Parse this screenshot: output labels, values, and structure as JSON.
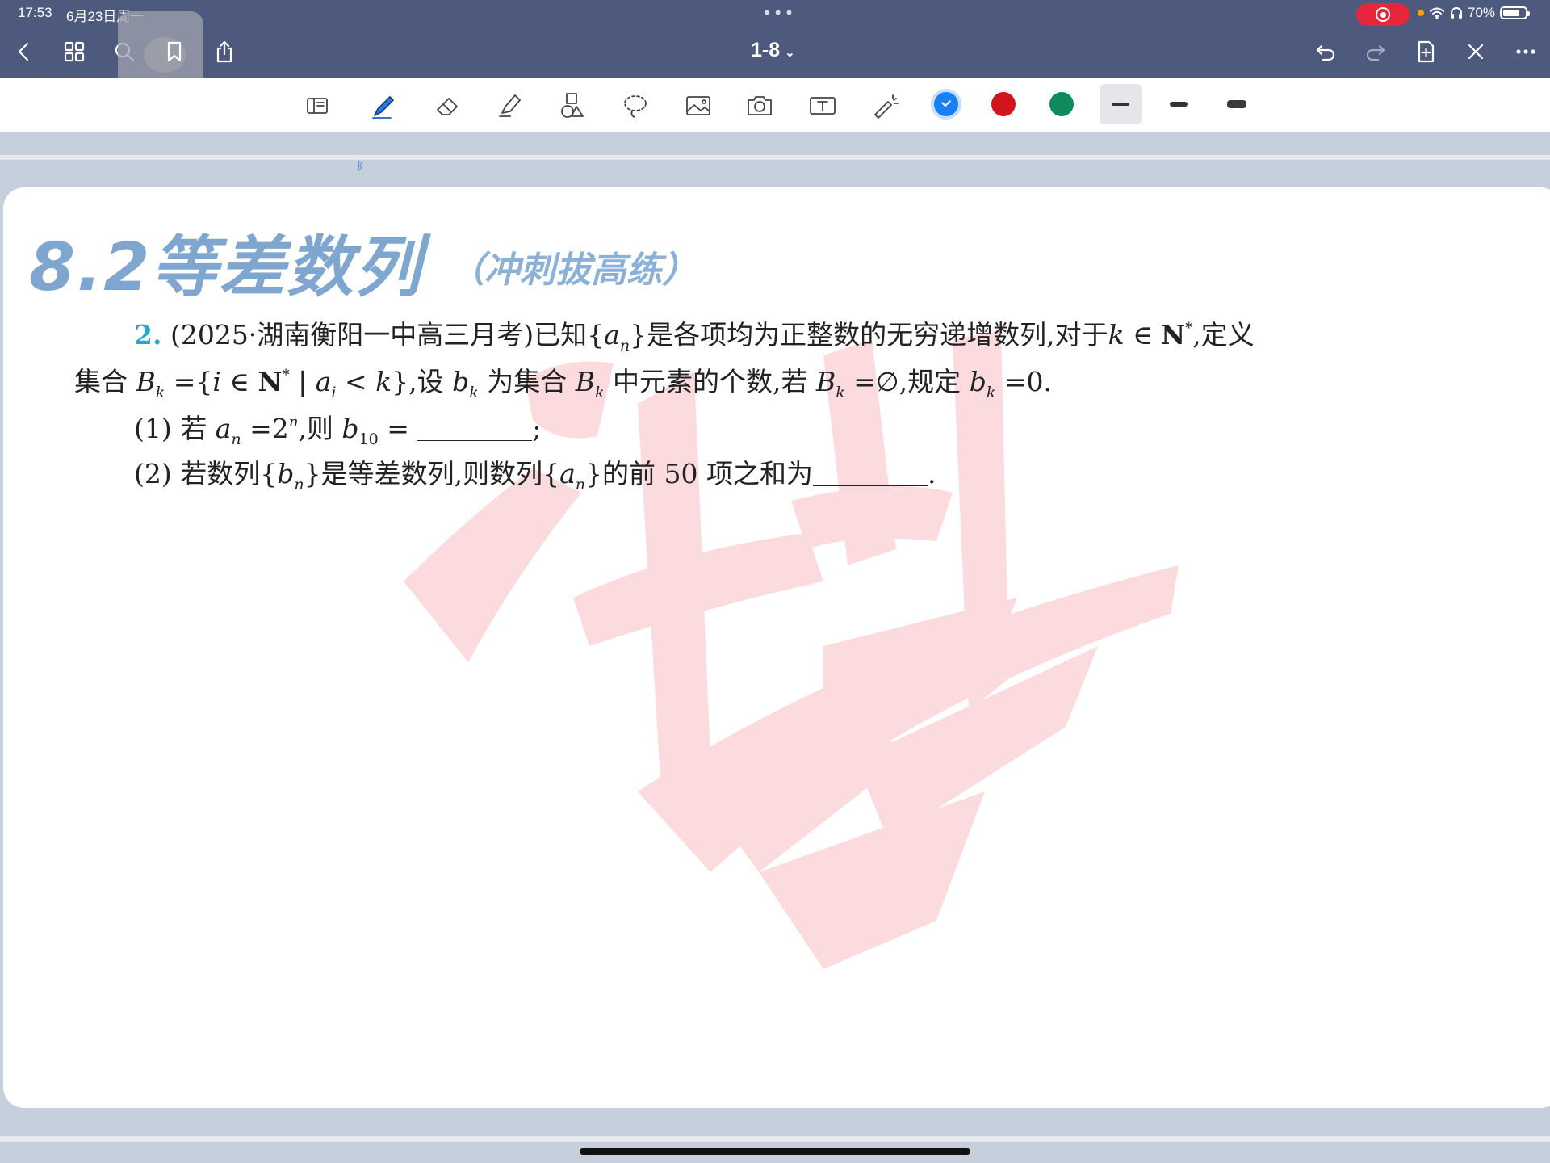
{
  "status_bar": {
    "time": "17:53",
    "date": "6月23日周一",
    "battery": "70%",
    "recording_color": "#e6263a"
  },
  "toolbar_top": {
    "doc_title": "1-8",
    "icons": [
      "back-icon",
      "grid-icon",
      "search-icon",
      "bookmark-icon",
      "share-icon",
      "undo-icon",
      "redo-icon",
      "add-page-icon",
      "close-icon",
      "more-icon"
    ]
  },
  "tools": {
    "icons": [
      "page-layout-icon",
      "pen-icon",
      "eraser-icon",
      "highlighter-icon",
      "shapes-icon",
      "lasso-icon",
      "image-icon",
      "camera-icon",
      "text-box-icon",
      "laser-pointer-icon"
    ],
    "colors": [
      "#1a7ff0",
      "#d4141c",
      "#0f8a5c"
    ],
    "selected_color": "#1a7ff0"
  },
  "worksheet": {
    "title": "8.2等差数列",
    "subtitle": "（冲刺拔高练）",
    "q_num": "2.",
    "q1_source": "(2025·湖南衡阳一中高三月考)已知{",
    "q1_a": "a",
    "q1_n": "n",
    "q1_rest": "}是各项均为正整数的无穷递增数列,对于",
    "q1_k": "k",
    "q1_in": " ∈ ",
    "q1_N": "N",
    "q1_star": "*",
    "q1_end": ",定义",
    "q2_start": "集合",
    "q2_B": "B",
    "q2_k": "k",
    "q2_eq": " ={",
    "q2_i": "i",
    "q2_in": " ∈ ",
    "q2_N": "N",
    "q2_star": "*",
    "q2_bar": " | ",
    "q2_a": "a",
    "q2_ai": "i",
    "q2_lt": " < ",
    "q2_k2": "k",
    "q2_close": "},设",
    "q2_b": "b",
    "q2_bk": "k",
    "q2_mid": "为集合",
    "q2_B2": "B",
    "q2_Bk2": "k",
    "q2_mid2": "中元素的个数,若",
    "q2_B3": "B",
    "q2_Bk3": "k",
    "q2_empty": " =∅,规定",
    "q2_b2": "b",
    "q2_bk2": "k",
    "q2_zero": " =0.",
    "p1_label": "(1) 若",
    "p1_a": "a",
    "p1_n": "n",
    "p1_eq": " =2",
    "p1_exp": "n",
    "p1_mid": ",则",
    "p1_b": "b",
    "p1_sub": "10",
    "p1_eq2": " =",
    "p1_end": ";",
    "p2_label": "(2) 若数列{",
    "p2_b": "b",
    "p2_n": "n",
    "p2_mid": "}是等差数列,则数列{",
    "p2_a": "a",
    "p2_n2": "n",
    "p2_end": "}的前 50 项之和为",
    "p2_period": "."
  }
}
